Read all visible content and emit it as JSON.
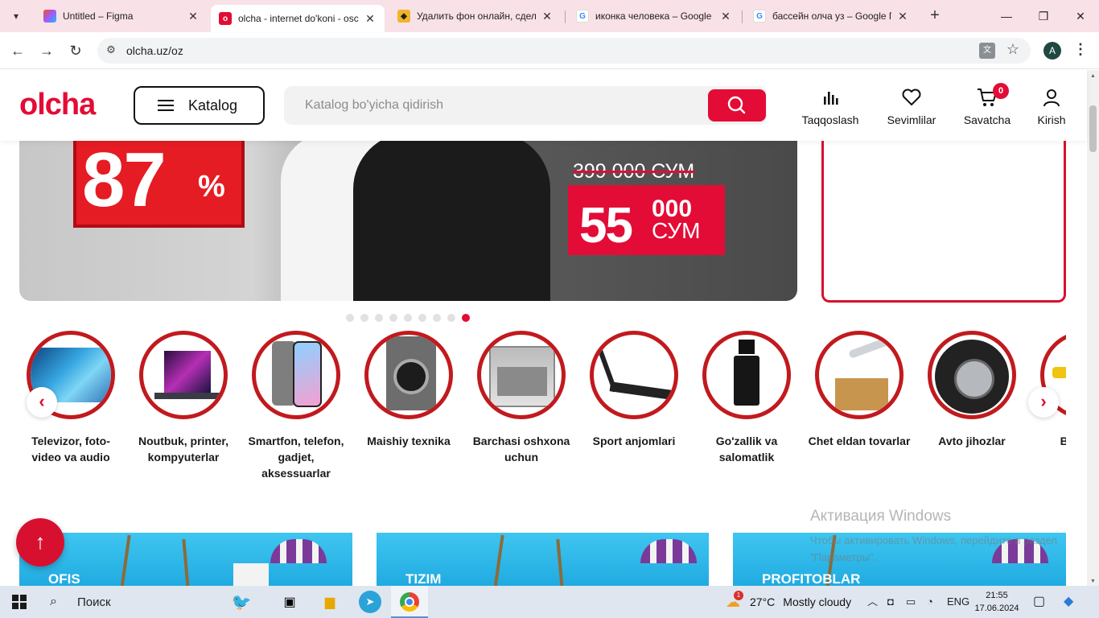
{
  "browser": {
    "tabs": [
      {
        "title": "Untitled – Figma",
        "favicon": "figma-icon",
        "active": false
      },
      {
        "title": "olcha - internet do'koni - osc",
        "favicon": "olcha-icon",
        "active": true
      },
      {
        "title": "Удалить фон онлайн, сдела",
        "favicon": "remove-bg-icon",
        "active": false
      },
      {
        "title": "иконка человека – Google I",
        "favicon": "google-icon",
        "active": false
      },
      {
        "title": "бассейн олча уз – Google П",
        "favicon": "google-icon",
        "active": false
      }
    ],
    "url": "olcha.uz/oz",
    "profile_initial": "A"
  },
  "header": {
    "logo": "olcha",
    "katalog_label": "Katalog",
    "search_placeholder": "Katalog bo'yicha qidirish",
    "actions": {
      "compare": "Taqqoslash",
      "favorites": "Sevimlilar",
      "cart": "Savatcha",
      "cart_count": "0",
      "login": "Kirish"
    }
  },
  "banner": {
    "discount_number": "87",
    "discount_sign": "%",
    "old_price": "399 000 СУМ",
    "new_price_main": "55",
    "new_price_thousands": "000",
    "currency": "СУМ",
    "slide_count": 9,
    "active_slide": 9
  },
  "categories": [
    {
      "label": "Televizor, foto-video va audio",
      "icon": "tv-icon"
    },
    {
      "label": "Noutbuk, printer, kompyuterlar",
      "icon": "laptop-icon"
    },
    {
      "label": "Smartfon, telefon, gadjet, aksessuarlar",
      "icon": "smartphone-icon"
    },
    {
      "label": "Maishiy texnika",
      "icon": "washing-machine-icon"
    },
    {
      "label": "Barchasi oshxona uchun",
      "icon": "oven-icon"
    },
    {
      "label": "Sport anjomlari",
      "icon": "treadmill-icon"
    },
    {
      "label": "Go'zallik va salomatlik",
      "icon": "perfume-icon"
    },
    {
      "label": "Chet eldan tovarlar",
      "icon": "import-boxes-icon"
    },
    {
      "label": "Avto jihozlar",
      "icon": "tire-icon"
    },
    {
      "label": "Barch bo",
      "icon": "tools-icon"
    }
  ],
  "promo_tiles": [
    "OFIS",
    "TIZIM",
    "PROFITOBLAR"
  ],
  "watermark": {
    "title": "Активация Windows",
    "subtitle": "Чтобы активировать Windows, перейдите в раздел \"Параметры\"."
  },
  "taskbar": {
    "search_label": "Поиск",
    "weather_temp": "27°C",
    "weather_desc": "Mostly cloudy",
    "weather_alert": "1",
    "language": "ENG",
    "time": "21:55",
    "date": "17.06.2024"
  },
  "colors": {
    "brand": "#e30c36",
    "tab_strip": "#f8e1e7",
    "taskbar": "#dfe6ef"
  }
}
